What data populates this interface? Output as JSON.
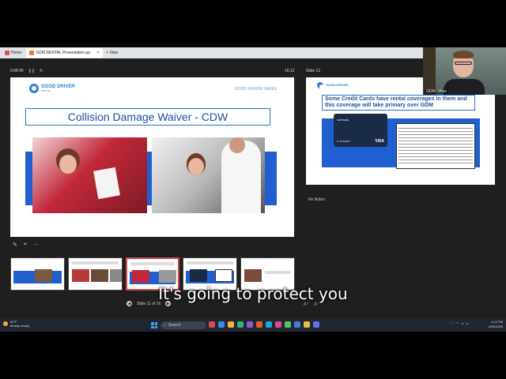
{
  "browser": {
    "tabs": [
      {
        "label": "Home",
        "color": "#d9534f"
      },
      {
        "label": "GDM RENTAL Presentation.pp",
        "color": "#e8792b"
      }
    ],
    "new_tab_label": "New"
  },
  "presenter": {
    "timer": "0:08:45",
    "timer_controls": [
      "❙❙",
      "↻"
    ],
    "clock": "16:12",
    "current_slide": {
      "logo_text": "GOOD DRIVER",
      "logo_sub": "MUTUAL",
      "brand_right": "GOOD DRIVER SAVES",
      "title": "Collision Damage Waiver - CDW"
    },
    "tool_icons": [
      "✎",
      "⌖",
      "⋯"
    ],
    "slide_counter": "Slide 11 of 16",
    "next_label": "Slide 12",
    "next_slide": {
      "title": "Some Credit Cards have rental coverages in them and this coverage will take primary over GDM",
      "card_brand": "SAPPHIRE",
      "card_name": "B. BARNETT",
      "card_network": "VISA"
    },
    "notes": "No Notes"
  },
  "webcam": {
    "label": "GDM Office"
  },
  "caption": {
    "text": "It's going to protect you",
    "tools": [
      "A⁺",
      "A⁻"
    ]
  },
  "taskbar": {
    "weather_temp": "81°F",
    "weather_desc": "Mostly cloudy",
    "search_label": "Search",
    "app_colors": [
      "#e04a4a",
      "#3c8de0",
      "#f2b632",
      "#2bb673",
      "#8e5ad6",
      "#e05c2b",
      "#1fa3d9",
      "#d94a9a",
      "#5ac35a",
      "#4a7ad9",
      "#e8c040",
      "#6c6cf0"
    ],
    "time": "4:12 PM",
    "date": "8/30/2025"
  }
}
